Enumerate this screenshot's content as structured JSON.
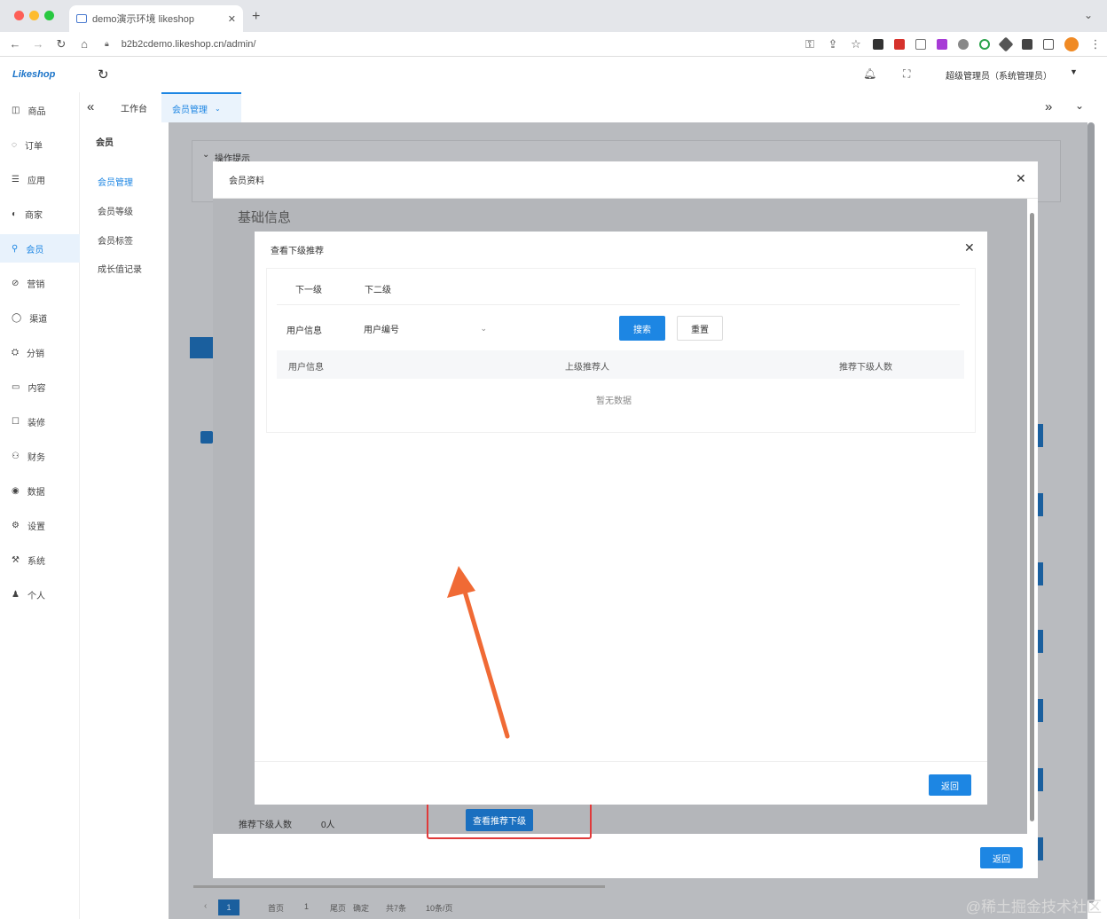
{
  "browser": {
    "tab_title": "demo演示环境 likeshop",
    "url": "b2b2cdemo.likeshop.cn/admin/"
  },
  "app": {
    "logo": "Likeshop",
    "user_label": "超级管理员（系统管理员）"
  },
  "sidebar": {
    "items": [
      {
        "label": "商品",
        "icon": "bag-icon"
      },
      {
        "label": "订单",
        "icon": "order-icon"
      },
      {
        "label": "应用",
        "icon": "app-icon"
      },
      {
        "label": "商家",
        "icon": "shop-icon"
      },
      {
        "label": "会员",
        "icon": "user-icon"
      },
      {
        "label": "营销",
        "icon": "marketing-icon"
      },
      {
        "label": "渠道",
        "icon": "channel-icon"
      },
      {
        "label": "分销",
        "icon": "distribution-icon"
      },
      {
        "label": "内容",
        "icon": "content-icon"
      },
      {
        "label": "装修",
        "icon": "decorate-icon"
      },
      {
        "label": "财务",
        "icon": "finance-icon"
      },
      {
        "label": "数据",
        "icon": "data-icon"
      },
      {
        "label": "设置",
        "icon": "settings-icon"
      },
      {
        "label": "系统",
        "icon": "system-icon"
      },
      {
        "label": "个人",
        "icon": "person-icon"
      }
    ],
    "active": "会员"
  },
  "submenu": {
    "heading": "会员",
    "items": [
      "会员管理",
      "会员等级",
      "会员标签",
      "成长值记录"
    ],
    "active": "会员管理"
  },
  "page_tabs": {
    "workspace": "工作台",
    "current": "会员管理"
  },
  "background": {
    "section_title": "操作提示",
    "basic_info": "基础信息",
    "referrer_count_label": "推荐下级人数",
    "referrer_count_value": "0人",
    "view_referrals_button": "查看推荐下级",
    "pagination": {
      "prev_label": "首页",
      "page": "1",
      "next_label": "尾页",
      "confirm": "确定",
      "total": "共7条",
      "page_size": "10条/页"
    }
  },
  "dialog_outer": {
    "title": "会员资料",
    "return_button": "返回"
  },
  "dialog_inner": {
    "title": "查看下级推荐",
    "tabs": [
      "下一级",
      "下二级"
    ],
    "filter_label": "用户信息",
    "filter_select": "用户编号",
    "search_button": "搜索",
    "reset_button": "重置",
    "columns": [
      "用户信息",
      "上级推荐人",
      "推荐下级人数"
    ],
    "empty_text": "暂无数据",
    "return_button": "返回"
  },
  "watermark": "@稀土掘金技术社区",
  "colors": {
    "primary": "#1d86e3",
    "highlight_box": "#e03a3a",
    "arrow": "#f06a35"
  }
}
